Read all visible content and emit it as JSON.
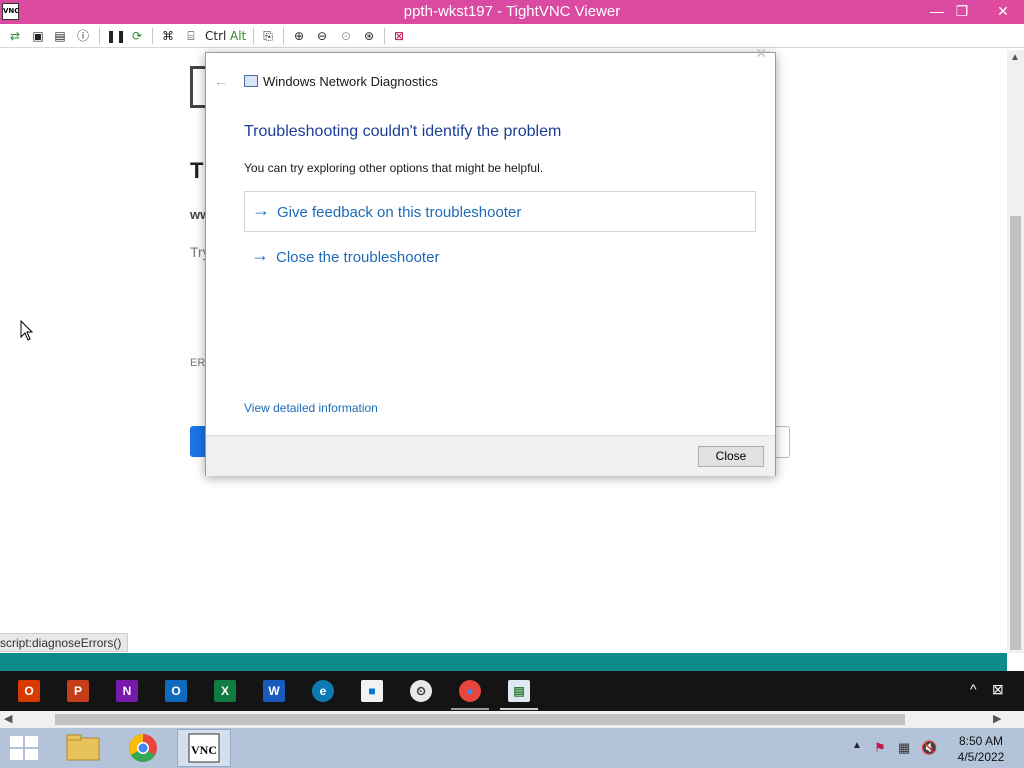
{
  "window": {
    "title": "ppth-wkst197 - TightVNC Viewer",
    "app_icon_text": "VNC",
    "minimize": "—",
    "maximize": "❐",
    "close": "✕"
  },
  "toolbar": {
    "ctrl_label": "Ctrl",
    "alt_label": "Alt",
    "icons": [
      "new-connection-icon",
      "save-icon",
      "options-icon",
      "info-icon",
      "pause-icon",
      "refresh-icon",
      "ctrl-alt-del-icon",
      "win-key-icon",
      "ctrl-key",
      "alt-key",
      "clipboard-icon",
      "zoom-in-icon",
      "zoom-out-icon",
      "zoom-100-icon",
      "zoom-auto-icon",
      "fullscreen-icon"
    ]
  },
  "background_page": {
    "heading_fragment": "T",
    "host_fragment": "ww",
    "try_fragment": "Try",
    "error_fragment": "ERI",
    "status_url": "script:diagnoseErrors()"
  },
  "dialog": {
    "app_title": "Windows Network Diagnostics",
    "back_glyph": "←",
    "heading": "Troubleshooting couldn't identify the problem",
    "subtext": "You can try exploring other options that might be helpful.",
    "options": [
      {
        "label": "Give feedback on this troubleshooter",
        "arrow": "→"
      },
      {
        "label": "Close the troubleshooter",
        "arrow": "→"
      }
    ],
    "details_link": "View detailed information",
    "close_button": "Close"
  },
  "remote_taskbar": {
    "apps": [
      {
        "name": "office",
        "glyph": "O",
        "color": "#d83b01"
      },
      {
        "name": "powerpoint",
        "glyph": "P",
        "color": "#c43e1c"
      },
      {
        "name": "onenote",
        "glyph": "N",
        "color": "#7719aa"
      },
      {
        "name": "outlook",
        "glyph": "O",
        "color": "#0f6cbd"
      },
      {
        "name": "excel",
        "glyph": "X",
        "color": "#107c41"
      },
      {
        "name": "word",
        "glyph": "W",
        "color": "#185abd"
      },
      {
        "name": "edge",
        "glyph": "e",
        "color": "#0c7bb3"
      },
      {
        "name": "store",
        "glyph": "■",
        "color": "#f2f2f2"
      },
      {
        "name": "clock-app",
        "glyph": "⏲",
        "color": "#e8e8e8"
      },
      {
        "name": "chrome",
        "glyph": "●",
        "color": "#e8453c"
      },
      {
        "name": "network-diagnostics",
        "glyph": "▤",
        "color": "#dfe8f3"
      }
    ],
    "tray_chevron": "^",
    "network_glyph": "⊠"
  },
  "local_taskbar": {
    "clock_time": "8:50 AM",
    "clock_date": "4/5/2022",
    "tray_up": "▲"
  }
}
